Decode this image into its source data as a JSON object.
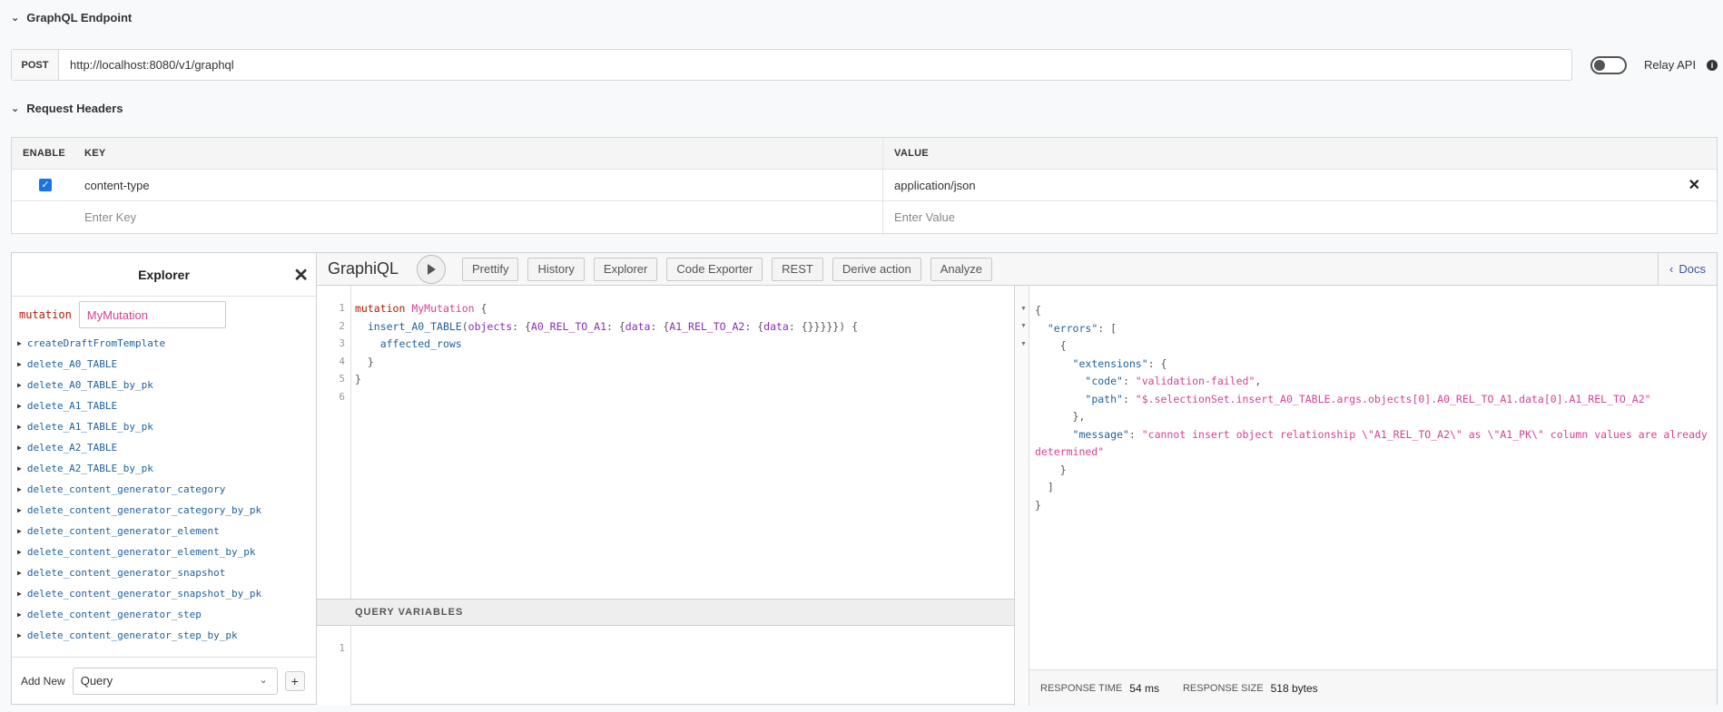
{
  "endpoint_section": {
    "title": "GraphQL Endpoint",
    "method": "POST",
    "url": "http://localhost:8080/v1/graphql",
    "relay_label": "Relay API"
  },
  "headers_section": {
    "title": "Request Headers",
    "columns": {
      "enable": "ENABLE",
      "key": "KEY",
      "value": "VALUE"
    },
    "rows": [
      {
        "key": "content-type",
        "value": "application/json",
        "enabled": true
      }
    ],
    "key_placeholder": "Enter Key",
    "value_placeholder": "Enter Value"
  },
  "explorer": {
    "title": "Explorer",
    "operation_keyword": "mutation",
    "operation_name": "MyMutation",
    "fields": [
      "createDraftFromTemplate",
      "delete_A0_TABLE",
      "delete_A0_TABLE_by_pk",
      "delete_A1_TABLE",
      "delete_A1_TABLE_by_pk",
      "delete_A2_TABLE",
      "delete_A2_TABLE_by_pk",
      "delete_content_generator_category",
      "delete_content_generator_category_by_pk",
      "delete_content_generator_element",
      "delete_content_generator_element_by_pk",
      "delete_content_generator_snapshot",
      "delete_content_generator_snapshot_by_pk",
      "delete_content_generator_step",
      "delete_content_generator_step_by_pk"
    ],
    "add_new_label": "Add New",
    "add_new_selected": "Query",
    "add_button": "+"
  },
  "toolbar": {
    "title": "GraphiQL",
    "buttons": [
      "Prettify",
      "History",
      "Explorer",
      "Code Exporter",
      "REST",
      "Derive action",
      "Analyze"
    ],
    "docs_label": "Docs"
  },
  "editor": {
    "line_numbers": [
      "1",
      "2",
      "3",
      "4",
      "5",
      "6"
    ],
    "query_text": "mutation MyMutation {\n  insert_A0_TABLE(objects: {A0_REL_TO_A1: {data: {A1_REL_TO_A2: {data: {}}}}}) {\n    affected_rows\n  }\n}"
  },
  "query_variables": {
    "title": "QUERY VARIABLES",
    "line_numbers": [
      "1"
    ]
  },
  "result": {
    "errors": [
      {
        "extensions": {
          "code": "validation-failed",
          "path": "$.selectionSet.insert_A0_TABLE.args.objects[0].A0_REL_TO_A1.data[0].A1_REL_TO_A2"
        },
        "message": "cannot insert object relationship \\\"A1_REL_TO_A2\\\" as \\\"A1_PK\\\" column values are already determined"
      }
    ],
    "response_time_label": "RESPONSE TIME",
    "response_time": "54 ms",
    "response_size_label": "RESPONSE SIZE",
    "response_size": "518 bytes"
  }
}
